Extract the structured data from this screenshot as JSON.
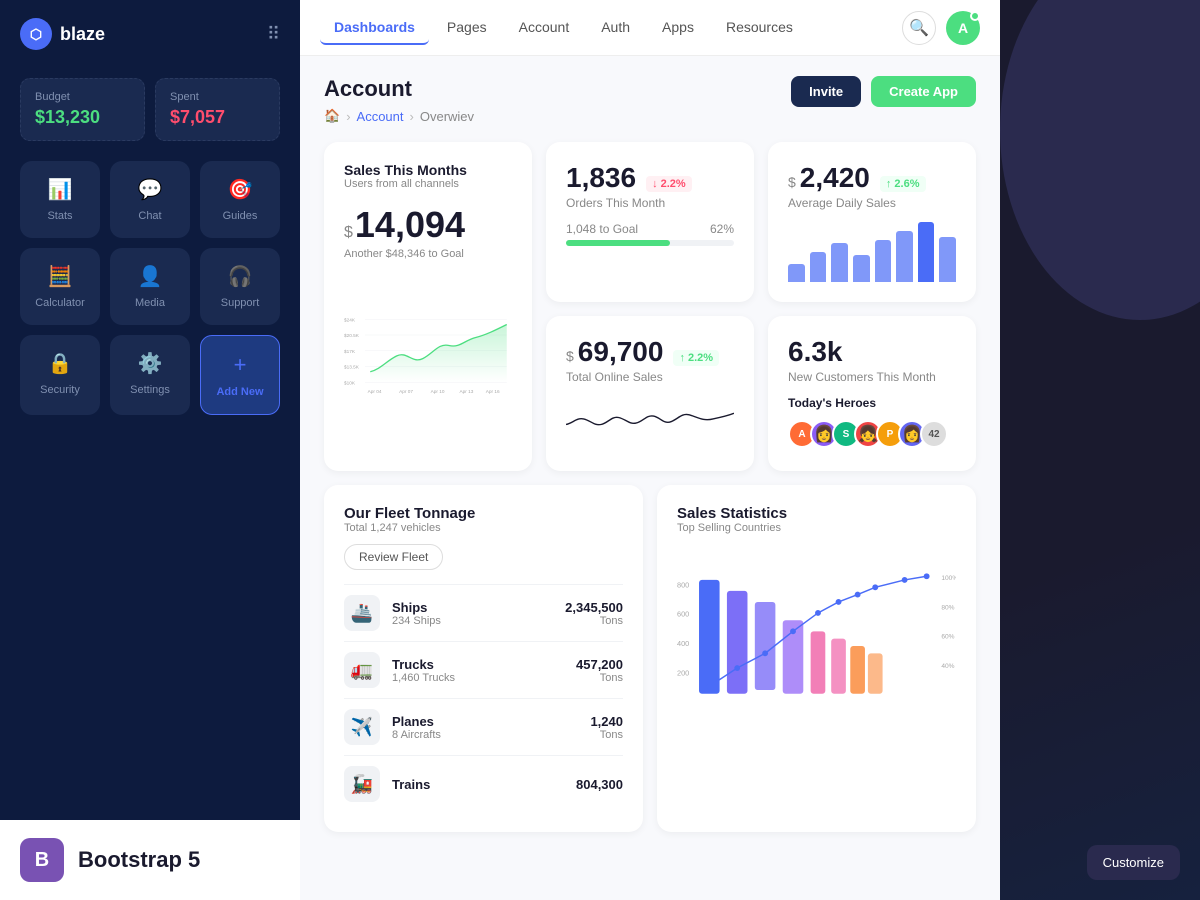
{
  "app": {
    "name": "blaze"
  },
  "sidebar": {
    "budget_label": "Budget",
    "budget_value": "$13,230",
    "spent_label": "Spent",
    "spent_value": "$7,057",
    "nav_items": [
      {
        "id": "stats",
        "label": "Stats",
        "icon": "📊"
      },
      {
        "id": "chat",
        "label": "Chat",
        "icon": "💬"
      },
      {
        "id": "guides",
        "label": "Guides",
        "icon": "🎯"
      },
      {
        "id": "calculator",
        "label": "Calculator",
        "icon": "🧮"
      },
      {
        "id": "media",
        "label": "Media",
        "icon": "👤"
      },
      {
        "id": "support",
        "label": "Support",
        "icon": "🎧"
      },
      {
        "id": "security",
        "label": "Security",
        "icon": "🔒"
      },
      {
        "id": "settings",
        "label": "Settings",
        "icon": "⚙️"
      },
      {
        "id": "add-new",
        "label": "+ Add New",
        "icon": "+"
      }
    ]
  },
  "topnav": {
    "tabs": [
      "Dashboards",
      "Pages",
      "Account",
      "Auth",
      "Apps",
      "Resources"
    ],
    "active_tab": "Dashboards"
  },
  "header": {
    "title": "Account",
    "breadcrumb": [
      "🏠",
      "Account",
      "Overwiev"
    ],
    "invite_label": "Invite",
    "create_app_label": "Create App"
  },
  "stats": {
    "orders": {
      "value": "1,836",
      "label": "Orders This Month",
      "change": "2.2%",
      "change_dir": "down",
      "goal_label": "1,048 to Goal",
      "goal_pct": 62
    },
    "daily_sales": {
      "prefix": "$",
      "value": "2,420",
      "label": "Average Daily Sales",
      "change": "2.6%",
      "change_dir": "up"
    },
    "sales_month": {
      "title": "Sales This Months",
      "subtitle": "Users from all channels",
      "prefix": "$",
      "value": "14,094",
      "goal_text": "Another $48,346 to Goal",
      "y_labels": [
        "$24K",
        "$20.5K",
        "$17K",
        "$13.5K",
        "$10K"
      ],
      "x_labels": [
        "Apr 04",
        "Apr 07",
        "Apr 10",
        "Apr 13",
        "Apr 16"
      ]
    },
    "online_sales": {
      "prefix": "$",
      "value": "69,700",
      "label": "Total Online Sales",
      "change": "2.2%",
      "change_dir": "up"
    },
    "customers": {
      "value": "6.3k",
      "label": "New Customers This Month",
      "heroes_label": "Today's Heroes"
    }
  },
  "fleet": {
    "title": "Our Fleet Tonnage",
    "subtitle": "Total 1,247 vehicles",
    "review_btn": "Review Fleet",
    "items": [
      {
        "icon": "🚢",
        "name": "Ships",
        "count": "234 Ships",
        "value": "2,345,500",
        "unit": "Tons"
      },
      {
        "icon": "🚛",
        "name": "Trucks",
        "count": "1,460 Trucks",
        "value": "457,200",
        "unit": "Tons"
      },
      {
        "icon": "✈️",
        "name": "Planes",
        "count": "8 Aircrafts",
        "value": "1,240",
        "unit": "Tons"
      },
      {
        "icon": "🚂",
        "name": "Trains",
        "count": "",
        "value": "804,300",
        "unit": ""
      }
    ]
  },
  "sales_stats": {
    "title": "Sales Statistics",
    "subtitle": "Top Selling Countries",
    "y_labels": [
      "800",
      "600",
      "400",
      "200"
    ]
  },
  "bootstrap": {
    "text": "Bootstrap 5",
    "icon": "B"
  },
  "customize": {
    "label": "Customize"
  }
}
